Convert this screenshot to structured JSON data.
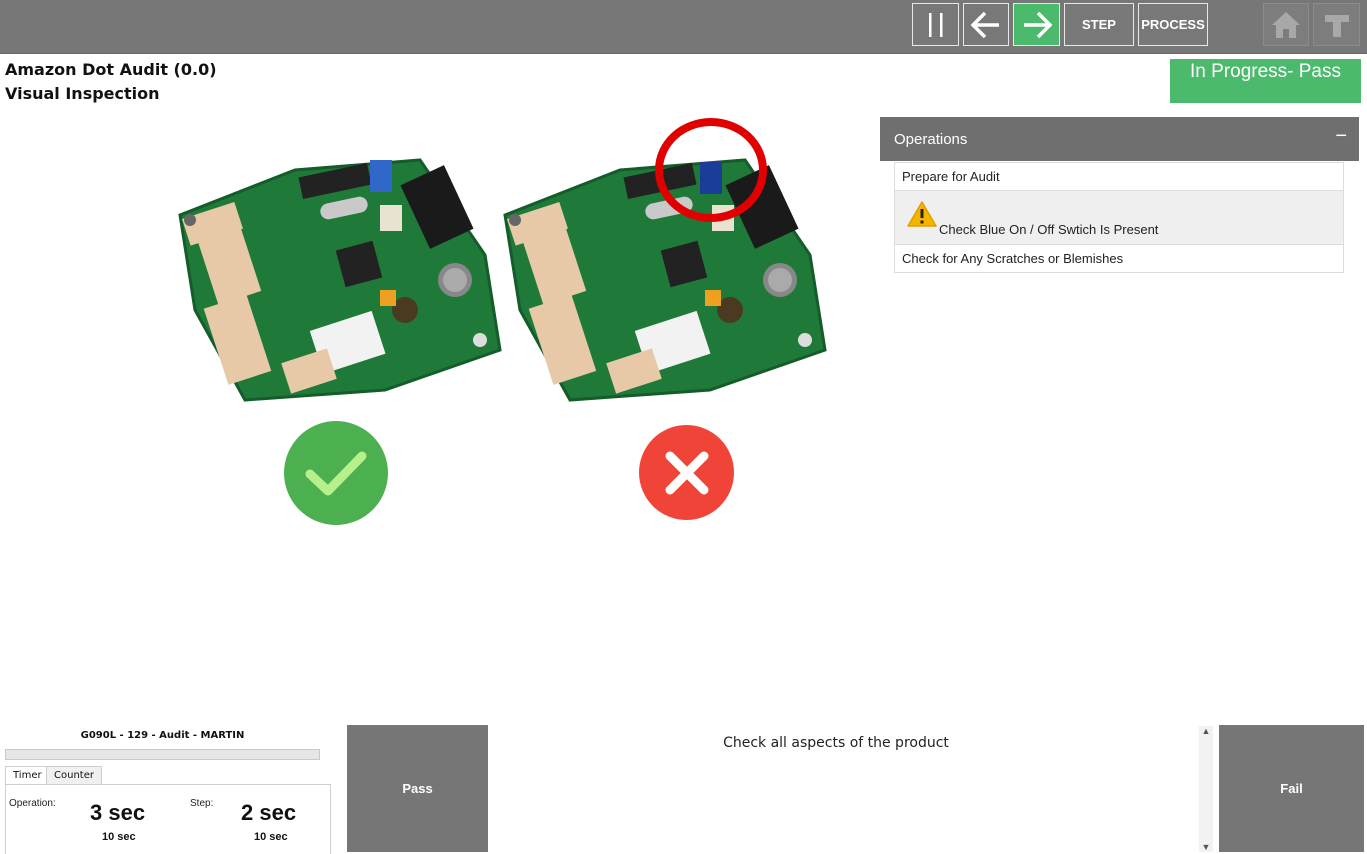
{
  "toolbar": {
    "step_label": "STEP",
    "process_label": "PROCESS"
  },
  "header": {
    "title": "Amazon Dot Audit (0.0)",
    "subtitle": "Visual Inspection",
    "status": "In Progress- Pass"
  },
  "operations": {
    "title": "Operations",
    "collapse_symbol": "−",
    "items": [
      {
        "label": "Prepare for Audit"
      },
      {
        "label": "Check Blue On / Off Swtich Is Present",
        "icon": "warning-icon"
      },
      {
        "label": "Check for Any Scratches or Blemishes"
      }
    ]
  },
  "footer": {
    "job_label": "G090L - 129 - Audit - MARTIN",
    "tabs": [
      "Timer",
      "Counter"
    ],
    "operation_label": "Operation:",
    "operation_time": "3 sec",
    "operation_limit": "10 sec",
    "step_label": "Step:",
    "step_time": "2 sec",
    "step_limit": "10 sec",
    "pass_label": "Pass",
    "fail_label": "Fail",
    "instructions": "Check all aspects of the product"
  },
  "colors": {
    "accent_green": "#4cba6c",
    "toolbar_gray": "#777777",
    "fail_red": "#f04439",
    "ok_green": "#4caf50",
    "highlight_red": "#e00000"
  }
}
